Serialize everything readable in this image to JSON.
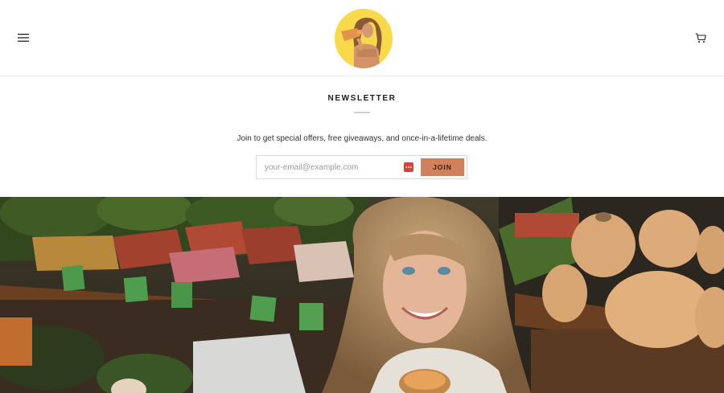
{
  "header": {
    "menu_icon": "hamburger-menu-icon",
    "logo_image": "portrait-on-yellow-circle",
    "cart_icon": "shopping-cart-icon"
  },
  "newsletter": {
    "title": "NEWSLETTER",
    "description": "Join to get special offers, free giveaways, and once-in-a-lifetime deals.",
    "email_placeholder": "your-email@example.com",
    "email_value": "",
    "autofill_icon": "password-manager-icon",
    "join_label": "JOIN"
  },
  "hero": {
    "image": "woman-smiling-at-produce-market"
  },
  "colors": {
    "logo_background": "#f8d94a",
    "join_button": "#d0805a",
    "join_text": "#3c1c0c",
    "autofill_icon": "#d5443a"
  }
}
